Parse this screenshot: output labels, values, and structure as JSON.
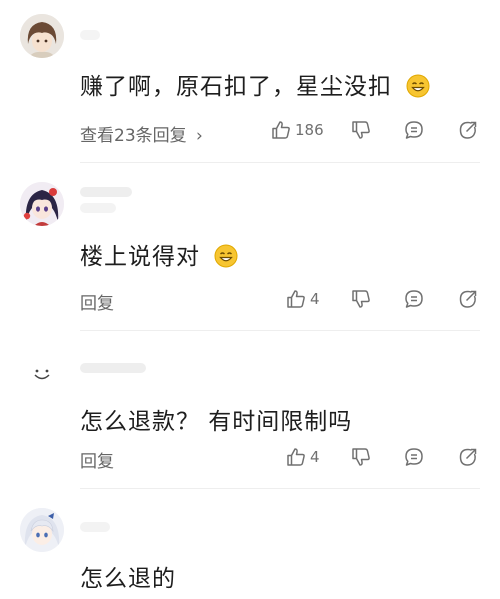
{
  "comments": [
    {
      "text": "赚了啊，原石扣了，星尘没扣",
      "reply_label": "查看23条回复",
      "reply_chevron": "›",
      "like_count": "186",
      "avatar_icon": "anime-boy-avatar",
      "emoji_icon": "smile-emoji"
    },
    {
      "text": "楼上说得对",
      "reply_label": "回复",
      "like_count": "4",
      "avatar_icon": "anime-girl-avatar",
      "emoji_icon": "smile-emoji"
    },
    {
      "text": "怎么退款？ 有时间限制吗",
      "reply_label": "回复",
      "like_count": "4",
      "avatar_icon": "smile-face-avatar"
    },
    {
      "text": "怎么退的",
      "avatar_icon": "white-hair-girl-avatar"
    }
  ],
  "icons": {
    "like": "thumbs-up-icon",
    "dislike": "thumbs-down-icon",
    "comment": "comment-icon",
    "share": "share-icon"
  },
  "colors": {
    "text": "#1e1e1e",
    "meta": "#666666",
    "icon": "#707070",
    "divider": "#eeeeee",
    "emoji": "#f7c531"
  }
}
